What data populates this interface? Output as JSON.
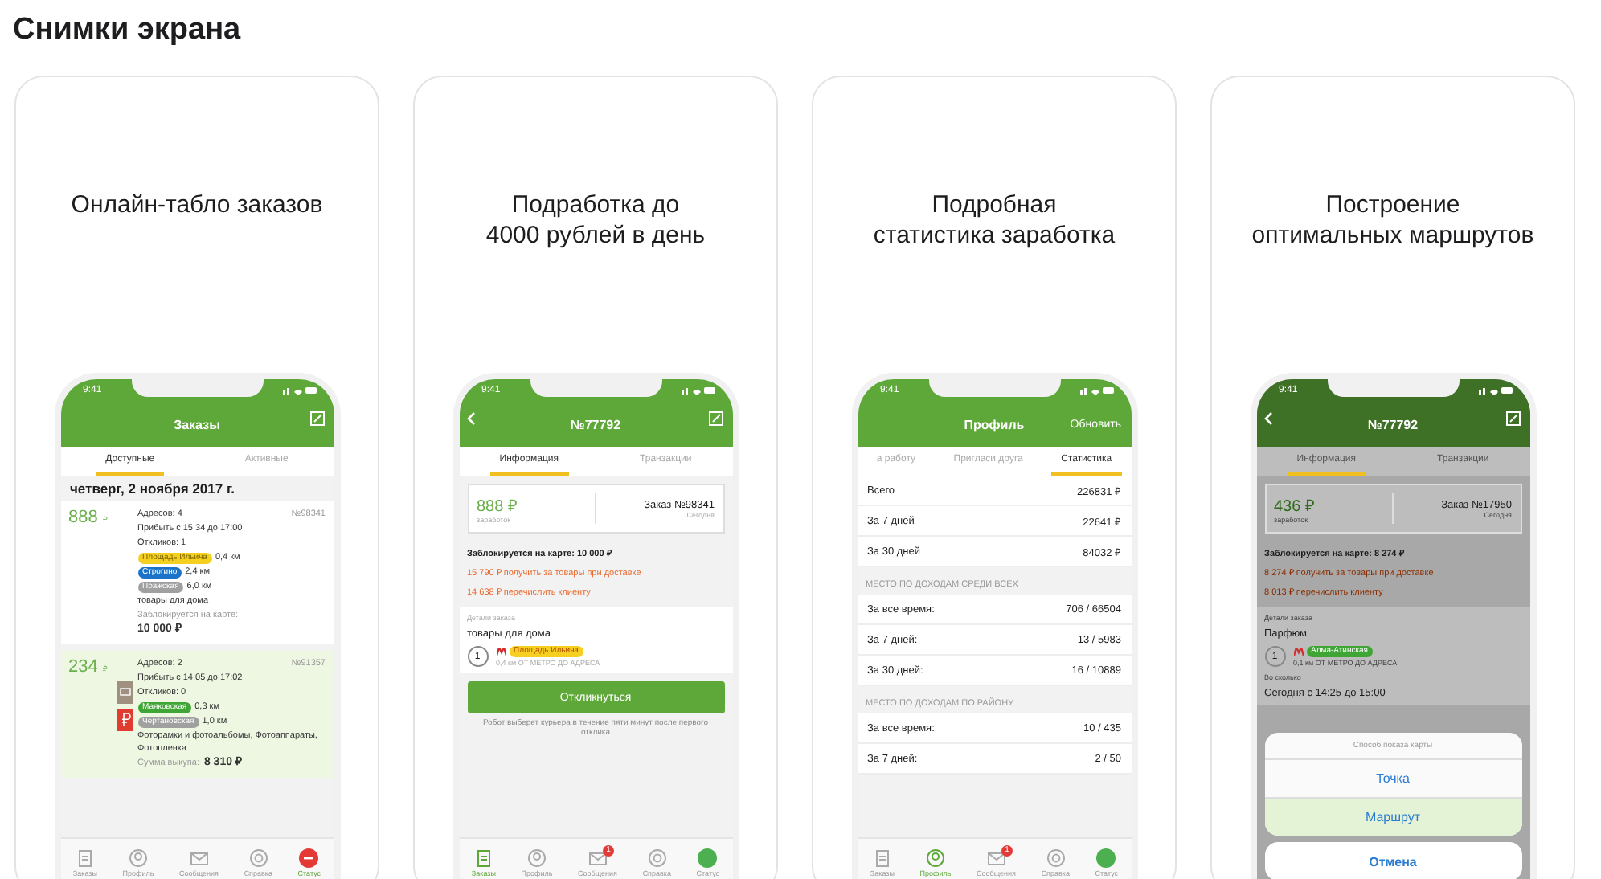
{
  "page_title": "Снимки экрана",
  "screens": [
    {
      "kind": "orders",
      "caption": "Онлайн-табло заказов",
      "time": "9:41",
      "title": "Заказы",
      "tabs": [
        {
          "label": "Доступные",
          "selected": true
        },
        {
          "label": "Активные",
          "selected": false
        }
      ],
      "date": "четверг, 2 ноября 2017 г.",
      "orders": [
        {
          "price": "888",
          "currency": "₽",
          "number": "№98341",
          "highlighted": false,
          "addresses": "Адресов: 4",
          "arrive": "Прибыть с 15:34 до 17:00",
          "responses": "Откликов: 1",
          "stations": [
            {
              "name": "Площадь Ильича",
              "color": "#f5d020",
              "distance": "0,4 км"
            },
            {
              "name": "Строгино",
              "color": "#1a73c8",
              "distance": "2,4 км"
            },
            {
              "name": "Пражская",
              "color": "#a0a0a0",
              "distance": "6,0 км"
            }
          ],
          "goods": "товары для дома",
          "amount_label": "Заблокируется на карте:",
          "amount": "10 000 ₽"
        },
        {
          "price": "234",
          "currency": "₽",
          "number": "№91357",
          "highlighted": true,
          "addresses": "Адресов: 2",
          "arrive": "Прибыть с 14:05 до 17:02",
          "responses": "Откликов: 0",
          "stations": [
            {
              "name": "Маяковская",
              "color": "#3fa535",
              "distance": "0,3 км"
            },
            {
              "name": "Чертановская",
              "color": "#a0a0a0",
              "distance": "1,0 км"
            }
          ],
          "goods": "Фоторамки и фотоальбомы, Фотоаппараты, Фотопленка",
          "amount_label": "Сумма выкупа:",
          "amount": "8 310 ₽",
          "badges": [
            {
              "kind": "card",
              "color": "#a09080"
            },
            {
              "kind": "ruble",
              "color": "#e03c31"
            }
          ]
        }
      ],
      "tabbar": [
        {
          "label": "Заказы",
          "selected": false
        },
        {
          "label": "Профиль",
          "selected": false
        },
        {
          "label": "Сообщения",
          "selected": false
        },
        {
          "label": "Справка",
          "selected": false
        },
        {
          "label": "Статус",
          "selected": true,
          "color": "#e53935"
        }
      ]
    },
    {
      "kind": "detail",
      "caption": "Подработка до 4000 рублей в день",
      "time": "9:41",
      "title": "№77792",
      "tabs": [
        {
          "label": "Информация",
          "selected": true
        },
        {
          "label": "Транзакции",
          "selected": false
        }
      ],
      "earning": "888 ₽",
      "earning_label": "заработок",
      "order": "Заказ №98341",
      "order_date": "Сегодня",
      "blocked": "Заблокируется на карте: 10 000 ₽",
      "notes": [
        "15 790 ₽ получить за товары при доставке",
        "14 638 ₽ перечислить клиенту"
      ],
      "details_label": "Детали заказа",
      "goods": "товары для дома",
      "step": "1",
      "station": {
        "name": "Площадь Ильича",
        "color": "#f5d020"
      },
      "station_note": "0,4 км ОТ МЕТРО ДО АДРЕСА",
      "button": "Откликнуться",
      "footnote": "Робот выберет курьера в течение пяти минут после первого отклика",
      "tabbar": [
        {
          "label": "Заказы",
          "selected": true
        },
        {
          "label": "Профиль",
          "selected": false
        },
        {
          "label": "Сообщения",
          "selected": false,
          "badge": "1"
        },
        {
          "label": "Справка",
          "selected": false
        },
        {
          "label": "Статус",
          "selected": false,
          "color": "#4caf50"
        }
      ]
    },
    {
      "kind": "stats",
      "caption": "Подробная статистика заработка",
      "time": "9:41",
      "title": "Профиль",
      "action": "Обновить",
      "tabs": [
        {
          "label": "а работу",
          "selected": false
        },
        {
          "label": "Пригласи друга",
          "selected": false
        },
        {
          "label": "Статистика",
          "selected": true
        }
      ],
      "groups": [
        {
          "rows": [
            {
              "label": "Всего",
              "value": "226831 ₽"
            },
            {
              "label": "За 7 дней",
              "value": "22641 ₽"
            },
            {
              "label": "За 30 дней",
              "value": "84032 ₽"
            }
          ]
        },
        {
          "heading": "МЕСТО ПО ДОХОДАМ СРЕДИ ВСЕХ",
          "rows": [
            {
              "label": "За все время:",
              "value": "706 / 66504"
            },
            {
              "label": "За 7 дней:",
              "value": "13 / 5983"
            },
            {
              "label": "За 30 дней:",
              "value": "16 / 10889"
            }
          ]
        },
        {
          "heading": "МЕСТО ПО ДОХОДАМ ПО РАЙОНУ",
          "rows": [
            {
              "label": "За все время:",
              "value": "10 / 435"
            },
            {
              "label": "За 7 дней:",
              "value": "2 / 50"
            }
          ]
        }
      ],
      "tabbar": [
        {
          "label": "Заказы",
          "selected": false
        },
        {
          "label": "Профиль",
          "selected": true
        },
        {
          "label": "Сообщения",
          "selected": false,
          "badge": "1"
        },
        {
          "label": "Справка",
          "selected": false
        },
        {
          "label": "Статус",
          "selected": false,
          "color": "#4caf50"
        }
      ]
    },
    {
      "kind": "detail",
      "caption": "Построение оптимальных маршрутов",
      "time": "9:41",
      "title": "№77792",
      "tabs": [
        {
          "label": "Информация",
          "selected": true
        },
        {
          "label": "Транзакции",
          "selected": false
        }
      ],
      "earning": "436 ₽",
      "earning_label": "заработок",
      "order": "Заказ №17950",
      "order_date": "Сегодня",
      "blocked": "Заблокируется на карте: 8 274 ₽",
      "notes": [
        "8 274 ₽ получить за товары при доставке",
        "8 013 ₽ перечислить клиенту"
      ],
      "details_label": "Детали заказа",
      "goods": "Парфюм",
      "step": "1",
      "station": {
        "name": "Алма-Атинская",
        "color": "#3fa535"
      },
      "station_note": "0,1 км ОТ МЕТРО ДО АДРЕСА",
      "when_label": "Во сколько",
      "when": "Сегодня с 14:25 до 15:00",
      "sheet": {
        "title": "Способ показа карты",
        "options": [
          {
            "label": "Точка",
            "selected": false
          },
          {
            "label": "Маршрут",
            "selected": true
          }
        ],
        "cancel": "Отмена"
      }
    }
  ]
}
